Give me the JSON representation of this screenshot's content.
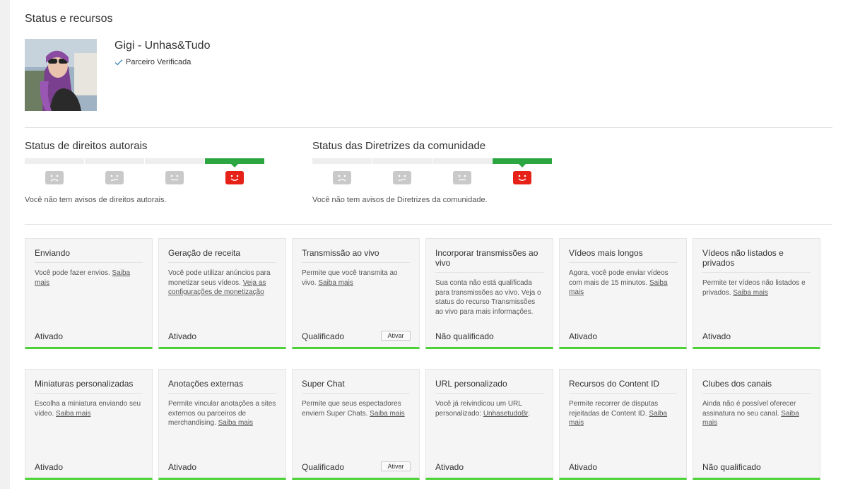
{
  "page": {
    "title": "Status e recursos"
  },
  "channel": {
    "name": "Gigi - Unhas&Tudo",
    "verified_label": "Parceiro Verificada"
  },
  "copyright": {
    "title": "Status de direitos autorais",
    "message": "Você não tem avisos de direitos autorais."
  },
  "community": {
    "title": "Status das Diretrizes da comunidade",
    "message": "Você não tem avisos de Diretrizes da comunidade."
  },
  "colors": {
    "active_bar": "#2ba640",
    "card_bottom": "#4cd137",
    "face_inactive": "#c9c9c9",
    "face_active": "#e62117"
  },
  "features_row1": [
    {
      "title": "Enviando",
      "desc": "Você pode fazer envios.",
      "link": "Saiba mais",
      "status": "Ativado"
    },
    {
      "title": "Geração de receita",
      "desc": "Você pode utilizar anúncios para monetizar seus vídeos.",
      "link": "Veja as configurações de monetização",
      "status": "Ativado"
    },
    {
      "title": "Transmissão ao vivo",
      "desc": "Permite que você transmita ao vivo.",
      "link": "Saiba mais",
      "status": "Qualificado",
      "button": "Ativar"
    },
    {
      "title": "Incorporar transmissões ao vivo",
      "desc": "Sua conta não está qualificada para transmissões ao vivo. Veja o status do recurso Transmissões ao vivo para mais informações.",
      "link": "",
      "status": "Não qualificado"
    },
    {
      "title": "Vídeos mais longos",
      "desc": "Agora, você pode enviar vídeos com mais de 15 minutos.",
      "link": "Saiba mais",
      "status": "Ativado"
    },
    {
      "title": "Vídeos não listados e privados",
      "desc": "Permite ter vídeos não listados e privados.",
      "link": "Saiba mais",
      "status": "Ativado"
    }
  ],
  "features_row2": [
    {
      "title": "Miniaturas personalizadas",
      "desc": "Escolha a miniatura enviando seu vídeo.",
      "link": "Saiba mais",
      "status": "Ativado"
    },
    {
      "title": "Anotações externas",
      "desc": "Permite vincular anotações a sites externos ou parceiros de merchandising.",
      "link": "Saiba mais",
      "status": "Ativado"
    },
    {
      "title": "Super Chat",
      "desc": "Permite que seus espectadores enviem Super Chats.",
      "link": "Saiba mais",
      "status": "Qualificado",
      "button": "Ativar"
    },
    {
      "title": "URL personalizado",
      "desc": "Você já reivindicou um URL personalizado:",
      "link": "UnhasetudoBr",
      "status": "Ativado"
    },
    {
      "title": "Recursos do Content ID",
      "desc": "Permite recorrer de disputas rejeitadas de Content ID.",
      "link": "Saiba mais",
      "status": "Ativado"
    },
    {
      "title": "Clubes dos canais",
      "desc": "Ainda não é possível oferecer assinatura no seu canal.",
      "link": "Saiba mais",
      "status": "Não qualificado"
    }
  ]
}
